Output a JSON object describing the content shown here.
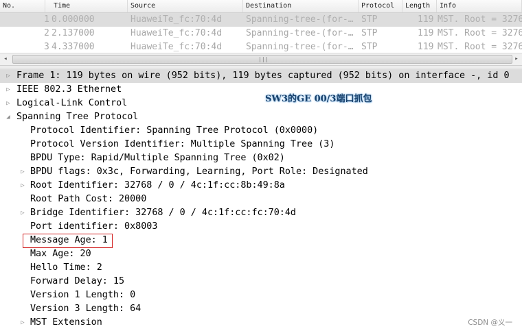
{
  "packet_list": {
    "columns": [
      "No.",
      "Time",
      "Source",
      "Destination",
      "Protocol",
      "Length",
      "Info"
    ],
    "rows": [
      {
        "no": "1",
        "time": "0.000000",
        "source": "HuaweiTe_fc:70:4d",
        "destination": "Spanning-tree-(for-…",
        "protocol": "STP",
        "length": "119",
        "info": "MST. Root = 3276"
      },
      {
        "no": "2",
        "time": "2.137000",
        "source": "HuaweiTe_fc:70:4d",
        "destination": "Spanning-tree-(for-…",
        "protocol": "STP",
        "length": "119",
        "info": "MST. Root = 3276"
      },
      {
        "no": "3",
        "time": "4.337000",
        "source": "HuaweiTe_fc:70:4d",
        "destination": "Spanning-tree-(for-…",
        "protocol": "STP",
        "length": "119",
        "info": "MST. Root = 3276"
      }
    ],
    "scrollbar": {
      "left_arrow": "◂",
      "right_arrow": "▸",
      "grip": "|||"
    }
  },
  "detail_tree": {
    "expander_collapsed": "▷",
    "expander_expanded": "◢",
    "frame": "Frame 1: 119 bytes on wire (952 bits), 119 bytes captured (952 bits) on interface -, id 0",
    "ethernet": "IEEE 802.3 Ethernet",
    "llc": "Logical-Link Control",
    "stp": "Spanning Tree Protocol",
    "fields": {
      "protocol_identifier": "Protocol Identifier: Spanning Tree Protocol (0x0000)",
      "protocol_version": "Protocol Version Identifier: Multiple Spanning Tree (3)",
      "bpdu_type": "BPDU Type: Rapid/Multiple Spanning Tree (0x02)",
      "bpdu_flags": "BPDU flags: 0x3c, Forwarding, Learning, Port Role: Designated",
      "root_identifier": "Root Identifier: 32768 / 0 / 4c:1f:cc:8b:49:8a",
      "root_path_cost": "Root Path Cost: 20000",
      "bridge_identifier": "Bridge Identifier: 32768 / 0 / 4c:1f:cc:fc:70:4d",
      "port_identifier": "Port identifier: 0x8003",
      "message_age": "Message Age: 1",
      "max_age": "Max Age: 20",
      "hello_time": "Hello Time: 2",
      "forward_delay": "Forward Delay: 15",
      "version1_length": "Version 1 Length: 0",
      "version3_length": "Version 3 Length: 64",
      "mst_extension": "MST Extension"
    }
  },
  "annotation": "SW3的GE 00/3端口抓包",
  "watermark": "CSDN @义一"
}
